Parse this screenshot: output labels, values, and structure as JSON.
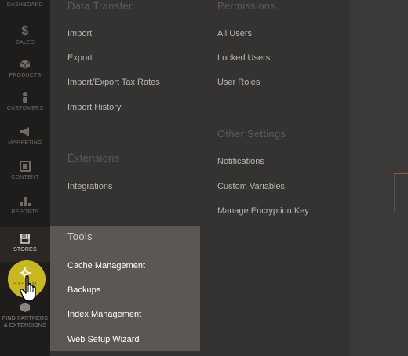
{
  "nav": {
    "items": [
      {
        "label": "DASHBOARD",
        "icon": "dashboard-icon"
      },
      {
        "label": "SALES",
        "icon": "dollar-icon"
      },
      {
        "label": "PRODUCTS",
        "icon": "cube-icon"
      },
      {
        "label": "CUSTOMERS",
        "icon": "person-icon"
      },
      {
        "label": "MARKETING",
        "icon": "megaphone-icon"
      },
      {
        "label": "CONTENT",
        "icon": "layout-icon"
      },
      {
        "label": "REPORTS",
        "icon": "bar-chart-icon"
      },
      {
        "label": "STORES",
        "icon": "store-icon"
      },
      {
        "label": "SYSTEM",
        "icon": "gear-icon"
      },
      {
        "label": "FIND PARTNERS & EXTENSIONS",
        "icon": "box-icon"
      }
    ]
  },
  "flyout": {
    "data_transfer": {
      "title": "Data Transfer",
      "links": [
        "Import",
        "Export",
        "Import/Export Tax Rates",
        "Import History"
      ]
    },
    "extensions": {
      "title": "Extensions",
      "links": [
        "Integrations"
      ]
    },
    "tools": {
      "title": "Tools",
      "links": [
        "Cache Management",
        "Backups",
        "Index Management",
        "Web Setup Wizard"
      ]
    },
    "permissions": {
      "title": "Permissions",
      "links": [
        "All Users",
        "Locked Users",
        "User Roles"
      ]
    },
    "other_settings": {
      "title": "Other Settings",
      "links": [
        "Notifications",
        "Custom Variables",
        "Manage Encryption Key"
      ]
    }
  },
  "colors": {
    "highlight": "#d9c623",
    "rail_bg": "#1f1d1c",
    "flyout_bg": "#353331",
    "tools_bg": "#5a5755"
  }
}
